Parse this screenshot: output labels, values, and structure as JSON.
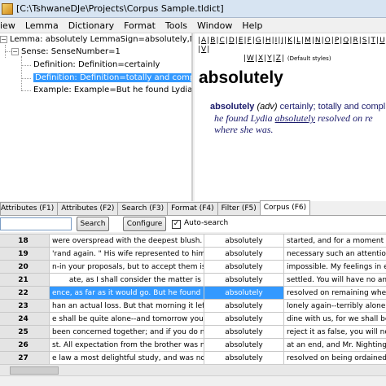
{
  "window": {
    "title": "[C:\\TshwaneDJe\\Projects\\Corpus Sample.tldict]"
  },
  "menu": [
    "iew",
    "Lemma",
    "Dictionary",
    "Format",
    "Tools",
    "Window",
    "Help"
  ],
  "tree": {
    "lemma": "Lemma: absolutely  LemmaSign=absolutely,Mod",
    "sense": "Sense: SenseNumber=1",
    "definition1": "Definition: Definition=certainly",
    "definition2": "Definition: Definition=totally and complete",
    "example": "Example: Example=But he found Lydia ~"
  },
  "preview": {
    "alphabet": [
      "A",
      "B",
      "C",
      "D",
      "E",
      "F",
      "G",
      "H",
      "I",
      "J",
      "K",
      "L",
      "M",
      "N",
      "O",
      "P",
      "Q",
      "R",
      "S",
      "T",
      "U",
      "V",
      "W",
      "X",
      "Y",
      "Z"
    ],
    "styles_label": "(Default styles)",
    "headword": "absolutely",
    "entry_lemma": "absolutely",
    "entry_pos": "(adv)",
    "entry_def": "certainly; totally and compl",
    "example_pre": "he found Lydia",
    "example_kw": "absolutely",
    "example_post": "resolved on re",
    "example_line2": "where she was."
  },
  "tabs": [
    "Attributes (F1)",
    "Attributes (F2)",
    "Search (F3)",
    "Format (F4)",
    "Filter (F5)",
    "Corpus (F6)"
  ],
  "active_tab": 5,
  "toolbar": {
    "search_label": "Search",
    "configure_label": "Configure",
    "autosearch_label": "Auto-search",
    "autosearch_checked": "✓"
  },
  "grid": {
    "selected_row": 4,
    "rows": [
      {
        "n": "18",
        "left": "were overspread with the deepest blush.  He",
        "kw": "absolutely",
        "right": "started, and for a moment se"
      },
      {
        "n": "19",
        "left": "'rand again. \" His wife represented to him how",
        "kw": "absolutely",
        "right": "necessary such an attention w"
      },
      {
        "n": "20",
        "left": "n-in your proposals, but to accept them is",
        "kw": "absolutely",
        "right": "impossible.  My feelings in ev"
      },
      {
        "n": "21",
        "left": "ate, as I shall consider the matter is",
        "kw": "absolutely",
        "right": "settled.  You will have no ans"
      },
      {
        "n": "22",
        "left": "ence, as far as it would go.  But he found Lydia",
        "kw": "absolutely",
        "right": "resolved on remaining where"
      },
      {
        "n": "23",
        "left": "han an actual loss.  But that morning it left me",
        "kw": "absolutely",
        "right": "lonely again--terribly alone"
      },
      {
        "n": "24",
        "left": "e shall be quite alone--and tomorrow you must",
        "kw": "absolutely",
        "right": "dine with us, for we shall be"
      },
      {
        "n": "25",
        "left": "been concerned together; and if you do not",
        "kw": "absolutely",
        "right": "reject it as false, you will no"
      },
      {
        "n": "26",
        "left": "st.  All expectation from the brother was now",
        "kw": "absolutely",
        "right": "at an end, and Mr. Nightingal"
      },
      {
        "n": "27",
        "left": "e law a most delightful study, and was now",
        "kw": "absolutely",
        "right": "resolved on being ordained, i"
      }
    ]
  }
}
